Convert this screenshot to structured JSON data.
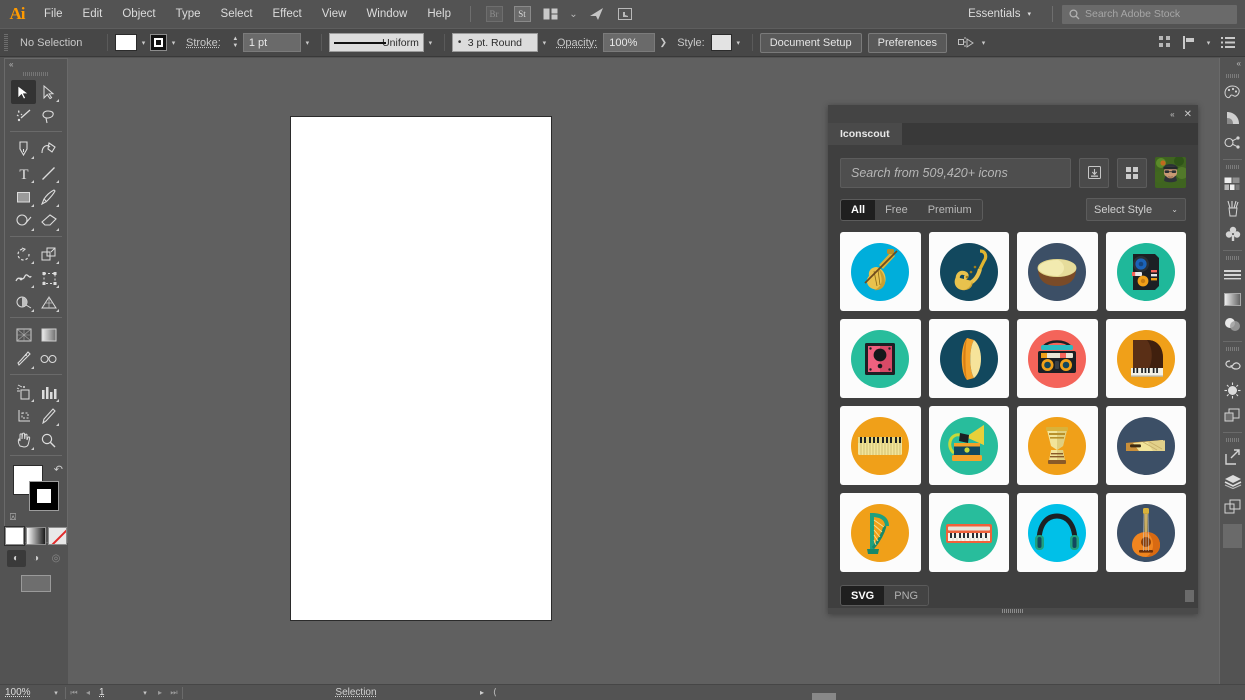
{
  "app": {
    "logo": "Ai",
    "menus": [
      "File",
      "Edit",
      "Object",
      "Type",
      "Select",
      "Effect",
      "View",
      "Window",
      "Help"
    ],
    "menubar_icons": [
      {
        "name": "bridge-badge",
        "label": "Br"
      },
      {
        "name": "stock-badge",
        "label": "St"
      },
      {
        "name": "arrange-documents-icon",
        "label": "▤"
      },
      {
        "name": "arrange-caret-icon",
        "label": "⌄"
      },
      {
        "name": "sync-settings-icon",
        "label": "➤"
      },
      {
        "name": "touch-workspace-icon",
        "label": "⬚"
      }
    ],
    "workspace": "Essentials",
    "stock_search_placeholder": "Search Adobe Stock"
  },
  "controlbar": {
    "selection_state": "No Selection",
    "fill_label": "fill-swatch",
    "stroke_color_label": "stroke-swatch",
    "stroke_label": "Stroke:",
    "stroke_weight": "1 pt",
    "stroke_profile": "Uniform",
    "brush_definition": "3 pt. Round",
    "opacity_label": "Opacity:",
    "opacity_value": "100%",
    "opacity_more": "❯",
    "style_label": "Style:",
    "document_setup": "Document Setup",
    "preferences": "Preferences",
    "align_icon": "align-to-icon",
    "right_icons": [
      "transform-grid-icon",
      "align-panel-icon",
      "panel-menu-icon"
    ]
  },
  "toolbar": {
    "collapse": "«",
    "tools": [
      {
        "name": "selection-tool",
        "glyph": "⬈",
        "selected": true,
        "corner": false
      },
      {
        "name": "direct-selection-tool",
        "glyph": "➤",
        "selected": false,
        "corner": true
      },
      {
        "name": "magic-wand-tool",
        "glyph": "✦",
        "selected": false,
        "corner": false
      },
      {
        "name": "lasso-tool",
        "glyph": "⬯",
        "selected": false,
        "corner": false
      },
      {
        "name": "pen-tool",
        "glyph": "✒",
        "selected": false,
        "corner": true
      },
      {
        "name": "curvature-tool",
        "glyph": "✎",
        "selected": false,
        "corner": false
      },
      {
        "name": "type-tool",
        "glyph": "T",
        "selected": false,
        "corner": true
      },
      {
        "name": "line-segment-tool",
        "glyph": "╱",
        "selected": false,
        "corner": true
      },
      {
        "name": "rectangle-tool",
        "glyph": "□",
        "selected": false,
        "corner": true
      },
      {
        "name": "paintbrush-tool",
        "glyph": "✐",
        "selected": false,
        "corner": true
      },
      {
        "name": "shaper-tool",
        "glyph": "⭯",
        "selected": false,
        "corner": true
      },
      {
        "name": "eraser-tool",
        "glyph": "⬓",
        "selected": false,
        "corner": true
      },
      {
        "name": "rotate-tool",
        "glyph": "↻",
        "selected": false,
        "corner": true
      },
      {
        "name": "scale-tool",
        "glyph": "⬌",
        "selected": false,
        "corner": true
      },
      {
        "name": "width-tool",
        "glyph": "∿",
        "selected": false,
        "corner": true
      },
      {
        "name": "free-transform-tool",
        "glyph": "⬚",
        "selected": false,
        "corner": true
      },
      {
        "name": "shape-builder-tool",
        "glyph": "◔",
        "selected": false,
        "corner": true
      },
      {
        "name": "perspective-grid-tool",
        "glyph": "◧",
        "selected": false,
        "corner": true
      },
      {
        "name": "mesh-tool",
        "glyph": "▦",
        "selected": false,
        "corner": false
      },
      {
        "name": "gradient-tool",
        "glyph": "▨",
        "selected": false,
        "corner": false
      },
      {
        "name": "eyedropper-tool",
        "glyph": "⚗",
        "selected": false,
        "corner": true
      },
      {
        "name": "blend-tool",
        "glyph": "◌",
        "selected": false,
        "corner": false
      },
      {
        "name": "symbol-sprayer-tool",
        "glyph": "❉",
        "selected": false,
        "corner": true
      },
      {
        "name": "column-graph-tool",
        "glyph": "ᴵ",
        "selected": false,
        "corner": true
      },
      {
        "name": "artboard-tool",
        "glyph": "⬚",
        "selected": false,
        "corner": false
      },
      {
        "name": "slice-tool",
        "glyph": "✂",
        "selected": false,
        "corner": true
      },
      {
        "name": "hand-tool",
        "glyph": "✋",
        "selected": false,
        "corner": true
      },
      {
        "name": "zoom-tool",
        "glyph": "⚲",
        "selected": false,
        "corner": false
      }
    ],
    "fill_swatch": "white",
    "stroke_swatch": "black",
    "swap_icon": "swap-fill-stroke-icon",
    "default_icon": "default-fill-stroke-icon",
    "color_modes": [
      "color-mode",
      "gradient-mode",
      "none-mode"
    ],
    "draw_modes": [
      "draw-normal",
      "draw-behind",
      "draw-inside"
    ],
    "screen_mode": "change-screen-mode"
  },
  "right_dock": {
    "collapse": "«",
    "groups": [
      [
        "color-panel-icon",
        "color-guide-icon",
        "edit-colors-icon"
      ],
      [
        "swatches-panel-icon",
        "brushes-panel-icon",
        "symbols-panel-icon"
      ],
      [
        "stroke-panel-icon",
        "gradient-panel-icon",
        "transparency-panel-icon"
      ],
      [
        "libraries-panel-icon",
        "appearance-panel-icon",
        "pathfinder-panel-icon"
      ],
      [
        "export-panel-icon",
        "layers-panel-icon",
        "artboards-panel-icon"
      ]
    ]
  },
  "statusbar": {
    "zoom": "100%",
    "page": "1",
    "status_text": "Selection",
    "first_icon": "first-artboard-icon",
    "prev_icon": "previous-artboard-icon",
    "next_icon": "next-artboard-icon",
    "last_icon": "last-artboard-icon"
  },
  "panel": {
    "title_collapse": "«",
    "title_close": "✕",
    "tab": "Iconscout",
    "search_placeholder": "Search from 509,420+ icons",
    "search_value": "",
    "download_icon": "save-download-icon",
    "grid_icon": "grid-view-icon",
    "avatar": "user-avatar",
    "filters": [
      {
        "label": "All",
        "active": true
      },
      {
        "label": "Free",
        "active": false
      },
      {
        "label": "Premium",
        "active": false
      }
    ],
    "style_select": "Select Style",
    "style_caret": "⌄",
    "formats": [
      {
        "label": "SVG",
        "active": true
      },
      {
        "label": "PNG",
        "active": false
      }
    ],
    "icons": [
      {
        "name": "violin-icon",
        "bg": "#00aedb",
        "shadow": "#0a93bd"
      },
      {
        "name": "saxophone-icon",
        "bg": "#12485e",
        "shadow": "#0d3a4c"
      },
      {
        "name": "drum-bowl-icon",
        "bg": "#3c4f66",
        "shadow": "#2f4154"
      },
      {
        "name": "dj-speaker-icon",
        "bg": "#1fb89a",
        "shadow": "#169b82"
      },
      {
        "name": "amplifier-icon",
        "bg": "#28bd9c",
        "shadow": "#1fa085"
      },
      {
        "name": "pick-shell-icon",
        "bg": "#12485e",
        "shadow": "#0d3a4c"
      },
      {
        "name": "boombox-icon",
        "bg": "#f4645a",
        "shadow": "#d9524a"
      },
      {
        "name": "grand-piano-icon",
        "bg": "#f0a019",
        "shadow": "#d18a12"
      },
      {
        "name": "accordion-icon",
        "bg": "#f0a019",
        "shadow": "#d18a12"
      },
      {
        "name": "gramophone-icon",
        "bg": "#28bd9c",
        "shadow": "#1fa085"
      },
      {
        "name": "djembe-drum-icon",
        "bg": "#f0a019",
        "shadow": "#d18a12"
      },
      {
        "name": "wood-block-icon",
        "bg": "#3c4f66",
        "shadow": "#2f4154"
      },
      {
        "name": "harp-icon",
        "bg": "#f0a019",
        "shadow": "#d18a12"
      },
      {
        "name": "keyboard-piano-icon",
        "bg": "#28bd9c",
        "shadow": "#1fa085"
      },
      {
        "name": "headphones-icon",
        "bg": "#00c0e8",
        "shadow": "#0aa4c6"
      },
      {
        "name": "acoustic-guitar-icon",
        "bg": "#3c4f66",
        "shadow": "#2f4154"
      }
    ]
  },
  "colors": {
    "chrome": "#535353",
    "controlbar": "#474747",
    "canvas": "#606060",
    "panel_bg": "#3f3f3f",
    "accent_orange": "#ff9a00",
    "artboard": "#ffffff"
  }
}
